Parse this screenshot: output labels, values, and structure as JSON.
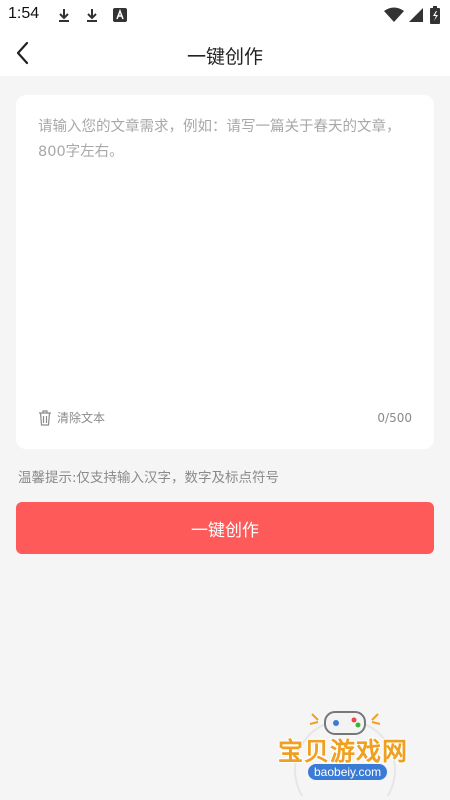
{
  "status_bar": {
    "time": "1:54",
    "left_icons": [
      "download-icon",
      "download-icon",
      "font-a-icon"
    ],
    "right_icons": [
      "wifi-icon",
      "cell-signal-icon",
      "battery-icon"
    ]
  },
  "header": {
    "title": "一键创作",
    "back_icon": "chevron-left-icon"
  },
  "editor": {
    "placeholder": "请输入您的文章需求，例如：请写一篇关于春天的文章，800字左右。",
    "value": "",
    "clear_label": "清除文本",
    "clear_icon": "trash-icon",
    "char_count": "0/500"
  },
  "tip": "温馨提示:仅支持输入汉字，数字及标点符号",
  "action": {
    "create_label": "一键创作"
  },
  "watermark": {
    "text": "宝贝游戏网",
    "url": "baobeiy.com"
  },
  "colors": {
    "accent": "#ff5a5a",
    "background": "#f5f5f5",
    "card": "#ffffff",
    "muted_text": "#8a8a8a"
  }
}
